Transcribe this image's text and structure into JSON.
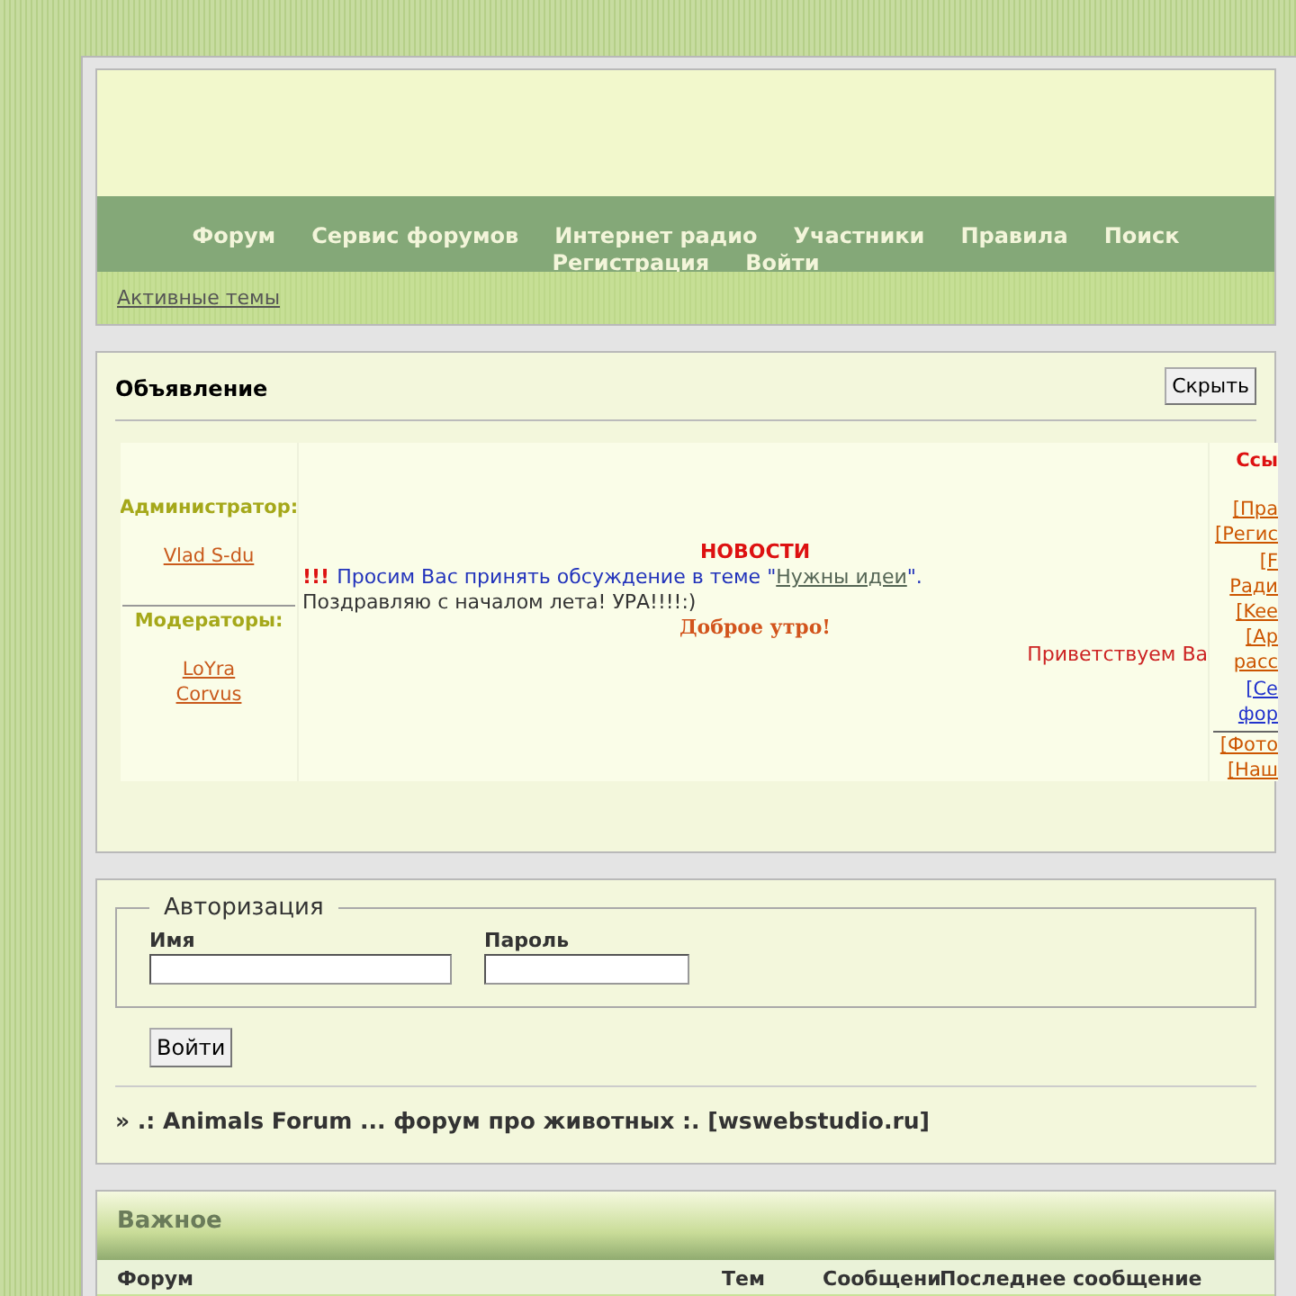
{
  "header": {
    "nav": [
      "Форум",
      "Сервис форумов",
      "Интернет радио",
      "Участники",
      "Правила",
      "Поиск",
      "Регистрация",
      "Войти"
    ],
    "subnav_link": "Активные темы"
  },
  "announcement": {
    "title": "Объявление",
    "hide_button": "Скрыть",
    "admin_label": "Администратор:",
    "admins": [
      "Vlad S-du"
    ],
    "moderators_label": "Модераторы:",
    "moderators": [
      "LoYra",
      "Corvus"
    ],
    "news_title": "НОВОСТИ",
    "alert_mark": "!!!",
    "notice_before": "Просим Вас принять обсуждение в теме \"",
    "notice_link": "Нужны идеи",
    "notice_after": "\".",
    "greeting": "Поздравляю с началом лета! УРА!!!!:)",
    "good_morning": "Доброе утро!",
    "welcome": "Приветствуем Ва",
    "links_title": "Ссы",
    "links": [
      {
        "text": "[Пра",
        "color": "#cc5500",
        "separator_before": false
      },
      {
        "text": "[Регис",
        "color": "#cc5500",
        "separator_before": false
      },
      {
        "text": "[F",
        "color": "#cc5500",
        "separator_before": false
      },
      {
        "text": "Ради",
        "color": "#cc5500",
        "separator_before": false
      },
      {
        "text": "[Kee",
        "color": "#cc5500",
        "separator_before": false
      },
      {
        "text": "[Ар",
        "color": "#cc5500",
        "separator_before": false
      },
      {
        "text": "расс",
        "color": "#cc5500",
        "separator_before": false
      },
      {
        "text": "[Се",
        "color": "#2233cc",
        "separator_before": false
      },
      {
        "text": "фор",
        "color": "#2233cc",
        "separator_before": false
      },
      {
        "text": "[Фото",
        "color": "#cc5500",
        "separator_before": true
      },
      {
        "text": "[Наш",
        "color": "#cc5500",
        "separator_before": false
      }
    ]
  },
  "auth": {
    "legend": "Авторизация",
    "fields": [
      {
        "label": "Имя",
        "kind": "wide"
      },
      {
        "label": "Пароль",
        "kind": "narrow"
      }
    ],
    "button": "Войти"
  },
  "board_title": "» .: Animals Forum ... форум про животных :. [wswebstudio.ru]",
  "category": {
    "title": "Важное",
    "columns": [
      "Форум",
      "Тем",
      "Сообщени",
      "Последнее сообщение"
    ]
  }
}
